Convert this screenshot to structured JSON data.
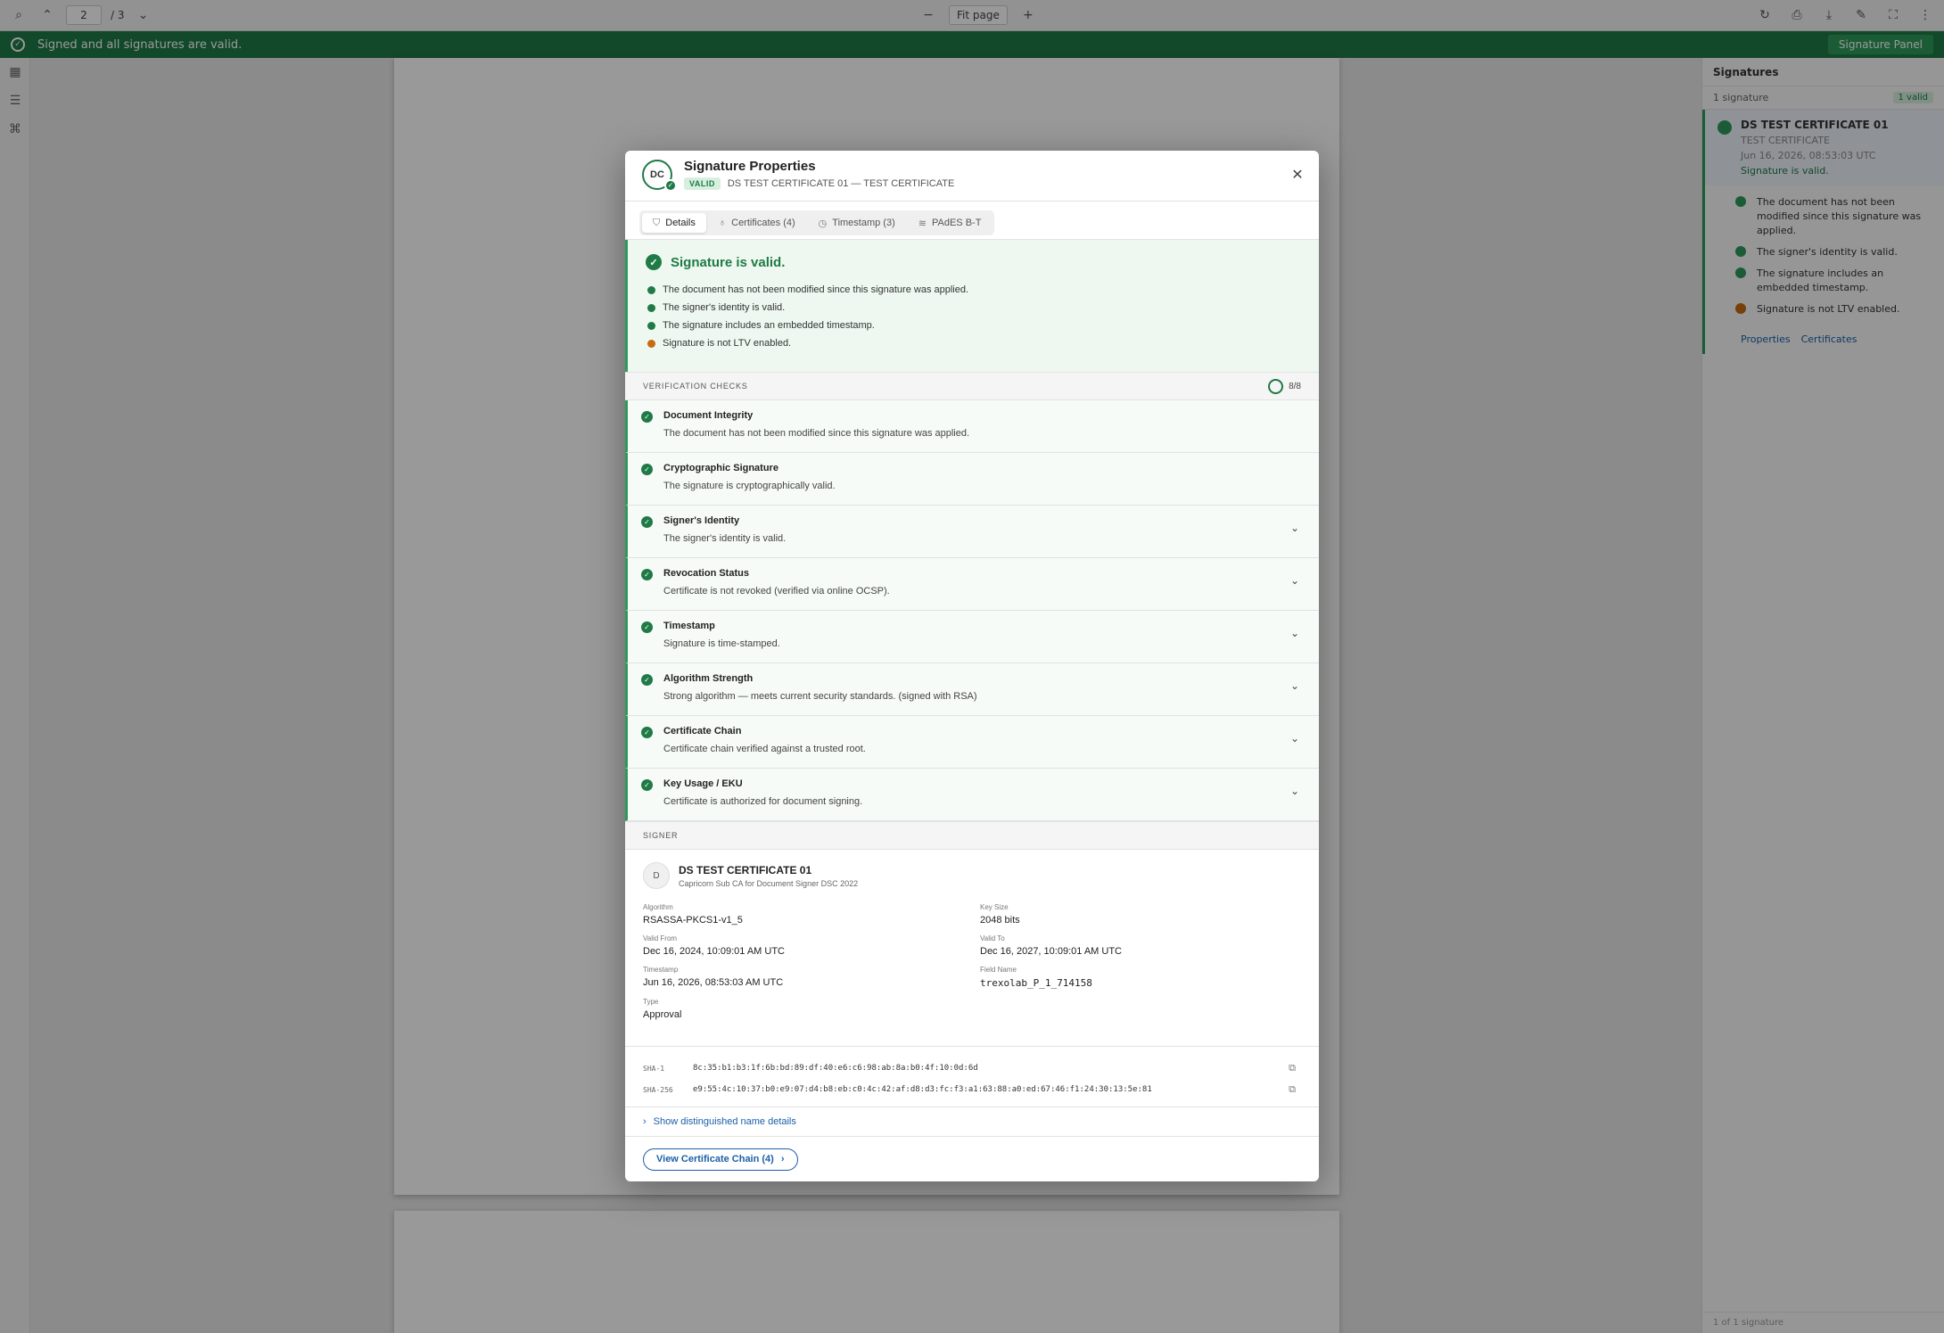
{
  "toolbar": {
    "page_current": "2",
    "page_total": "/ 3",
    "zoom_label": "Fit page"
  },
  "banner": {
    "text": "Signed and all signatures are valid.",
    "panel_button": "Signature Panel"
  },
  "signatures_panel": {
    "title": "Signatures",
    "subtitle": "1 signature",
    "badge": "1 valid",
    "item_name": "DS TEST CERTIFICATE 01",
    "item_sub": "TEST CERTIFICATE",
    "item_date": "Jun 16, 2026, 08:53:03 UTC",
    "item_status": "Signature is valid.",
    "checks": [
      "The document has not been modified since this signature was applied.",
      "The signer's identity is valid.",
      "The signature includes an embedded timestamp.",
      "Signature is not LTV enabled."
    ],
    "link_properties": "Properties",
    "link_certificates": "Certificates",
    "footer": "1 of 1 signature"
  },
  "dialog": {
    "avatar": "DC",
    "title": "Signature Properties",
    "badge": "VALID",
    "subtitle": "DS TEST CERTIFICATE 01 — TEST CERTIFICATE",
    "tabs": [
      {
        "label": "Details"
      },
      {
        "label": "Certificates (4)"
      },
      {
        "label": "Timestamp (3)"
      },
      {
        "label": "PAdES B-T"
      }
    ],
    "summary": {
      "heading": "Signature is valid.",
      "lines": [
        "The document has not been modified since this signature was applied.",
        "The signer's identity is valid.",
        "The signature includes an embedded timestamp.",
        "Signature is not LTV enabled."
      ]
    },
    "verification": {
      "heading": "VERIFICATION CHECKS",
      "score": "8/8",
      "checks": [
        {
          "title": "Document Integrity",
          "desc": "The document has not been modified since this signature was applied."
        },
        {
          "title": "Cryptographic Signature",
          "desc": "The signature is cryptographically valid."
        },
        {
          "title": "Signer's Identity",
          "desc": "The signer's identity is valid."
        },
        {
          "title": "Revocation Status",
          "desc": "Certificate is not revoked (verified via online OCSP)."
        },
        {
          "title": "Timestamp",
          "desc": "Signature is time-stamped."
        },
        {
          "title": "Algorithm Strength",
          "desc": "Strong algorithm — meets current security standards. (signed with RSA)"
        },
        {
          "title": "Certificate Chain",
          "desc": "Certificate chain verified against a trusted root."
        },
        {
          "title": "Key Usage / EKU",
          "desc": "Certificate is authorized for document signing."
        }
      ]
    },
    "signer": {
      "heading": "SIGNER",
      "avatar": "D",
      "name": "DS TEST CERTIFICATE 01",
      "issuer": "Capricorn Sub CA for Document Signer DSC 2022",
      "algorithm_label": "Algorithm",
      "algorithm": "RSASSA-PKCS1-v1_5",
      "keysize_label": "Key Size",
      "keysize": "2048 bits",
      "validfrom_label": "Valid From",
      "validfrom": "Dec 16, 2024, 10:09:01 AM UTC",
      "validto_label": "Valid To",
      "validto": "Dec 16, 2027, 10:09:01 AM UTC",
      "timestamp_label": "Timestamp",
      "timestamp": "Jun 16, 2026, 08:53:03 AM UTC",
      "fieldname_label": "Field Name",
      "fieldname": "trexolab_P_1_714158",
      "type_label": "Type",
      "type": "Approval"
    },
    "hashes": {
      "sha1_label": "SHA-1",
      "sha1": "8c:35:b1:b3:1f:6b:bd:89:df:40:e6:c6:98:ab:8a:b0:4f:10:0d:6d",
      "sha256_label": "SHA-256",
      "sha256": "e9:55:4c:10:37:b0:e9:07:d4:b8:eb:c0:4c:42:af:d8:d3:fc:f3:a1:63:88:a0:ed:67:46:f1:24:30:13:5e:81"
    },
    "dn_link": "Show distinguished name details",
    "footer_button": "View Certificate Chain (4)"
  }
}
